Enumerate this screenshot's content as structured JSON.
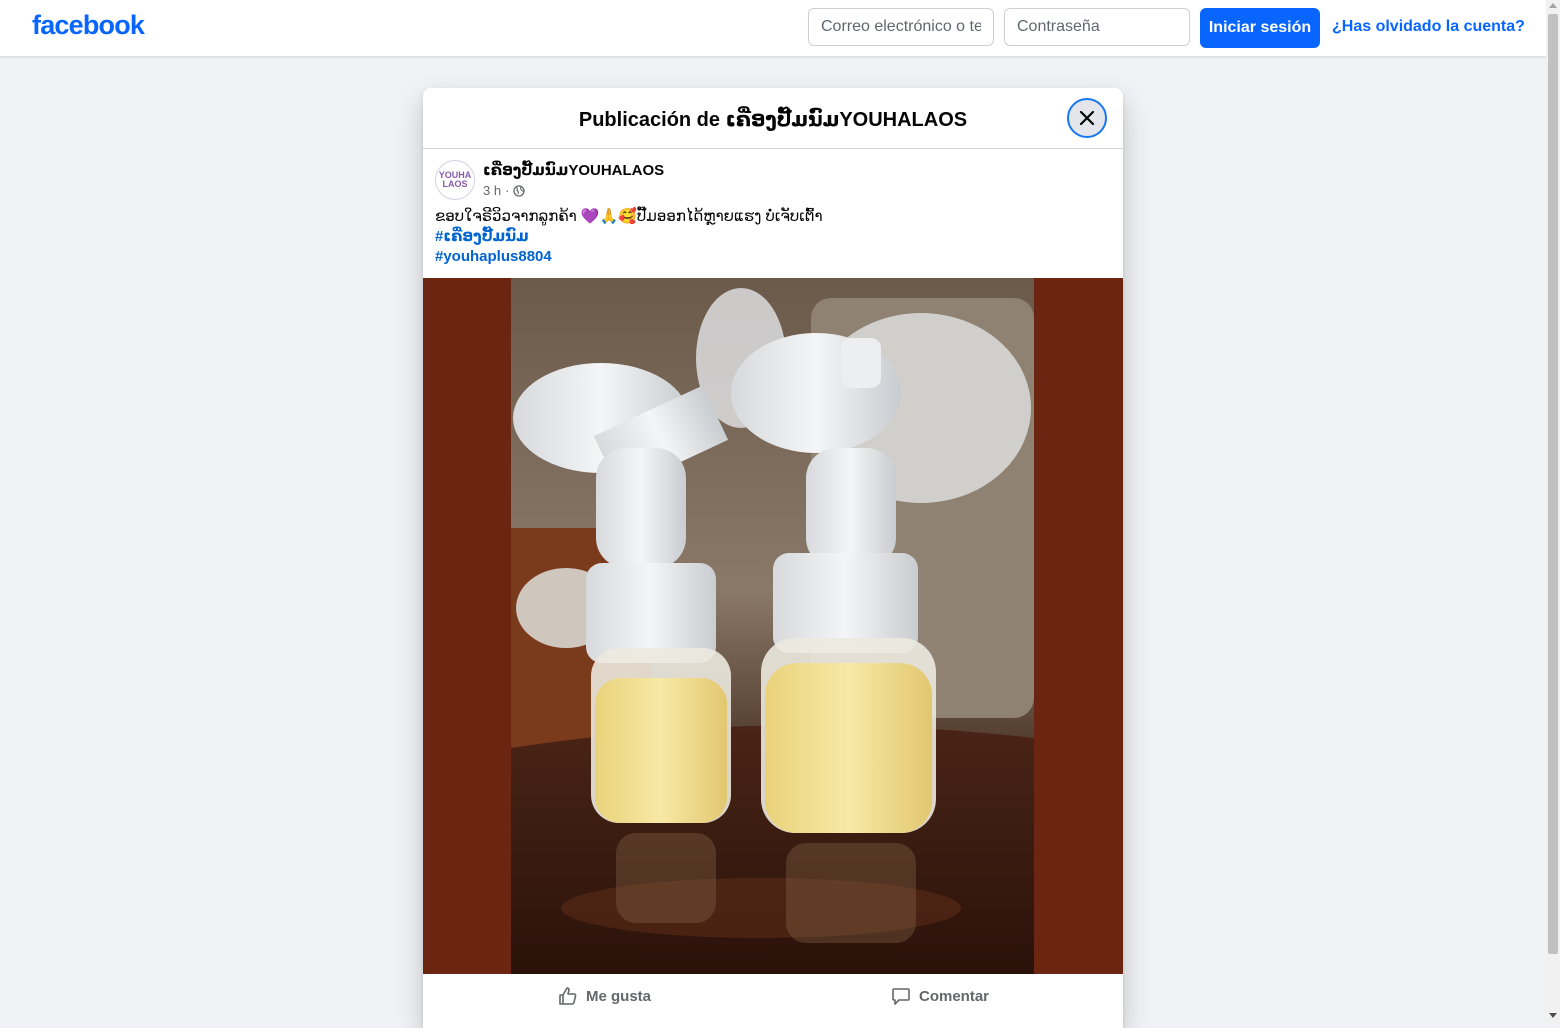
{
  "header": {
    "logo": "facebook",
    "email_placeholder": "Correo electrónico o teléfono",
    "password_placeholder": "Contraseña",
    "login_label": "Iniciar sesión",
    "forgot_label": "¿Has olvidado la cuenta?"
  },
  "modal": {
    "title": "Publicación de ເຄື່ອງປັ໊ມນົມYOUHALAOS"
  },
  "post": {
    "avatar_text_1": "YOUHA",
    "avatar_text_2": "LAOS",
    "author": "ເຄື່ອງປັ໊ມນົມYOUHALAOS",
    "time": "3 h",
    "separator": "·",
    "text": "ຂອບໃຈຣີວິວຈາກລູກຄ້າ 💜🙏🥰ປັ໊ມອອກໄດ້ຫຼາຍແຮງ ບໍ່ເຈັບເຕົ້າ",
    "hashtags": [
      "#ເຄື່ອງປັ໊ມນົມ",
      "#youhaplus8804"
    ]
  },
  "actions": {
    "like_label": "Me gusta",
    "comment_label": "Comentar"
  },
  "colors": {
    "brand": "#0866ff",
    "link": "#0064d1",
    "photo_background": "#6b2510"
  }
}
